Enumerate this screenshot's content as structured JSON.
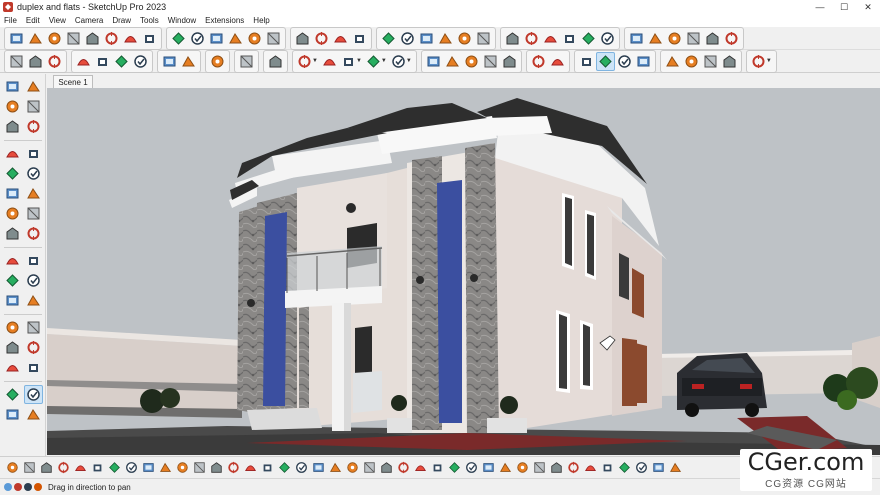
{
  "window": {
    "title": "duplex and flats - SketchUp Pro 2023",
    "controls": {
      "minimize": "—",
      "maximize": "☐",
      "close": "✕"
    }
  },
  "menu": [
    "File",
    "Edit",
    "View",
    "Camera",
    "Draw",
    "Tools",
    "Window",
    "Extensions",
    "Help"
  ],
  "toolbar_top": {
    "groups": [
      [
        "warehouse-icon",
        "paint-icon",
        "circle-icon",
        "ring-icon",
        "lamp-icon",
        "sun-icon",
        "dome-icon",
        "cylinder-icon"
      ],
      [
        "orbit-icon",
        "box-icon",
        "cube-icon",
        "plant-icon",
        "layers-icon",
        "box-outline-icon"
      ],
      [
        "grid-icon",
        "grid2-icon",
        "puzzle-icon",
        "grid3-icon"
      ],
      [
        "map-icon",
        "book-icon",
        "home-icon",
        "gift-icon",
        "house-icon",
        "door-icon"
      ],
      [
        "check-icon",
        "palette-icon",
        "teapot-icon",
        "shield-icon",
        "spiral-icon",
        "rocket-icon"
      ],
      [
        "monitor-icon",
        "chart-icon",
        "window-icon",
        "window2-icon",
        "window3-icon",
        "house-outline-icon"
      ]
    ]
  },
  "toolbar_main": {
    "groups": [
      [
        "new-file-icon",
        "folder-open-icon",
        "save-icon"
      ],
      [
        "cut-icon",
        "copy-icon",
        "paste-icon",
        "erase-icon"
      ],
      [
        "undo-icon",
        "redo-icon"
      ],
      [
        "print-icon"
      ],
      [
        "model-info-icon"
      ],
      [
        "search-zoom-icon"
      ],
      [
        "select-arrow-icon",
        "eraser-icon",
        "pencil-icon",
        "arc-icon",
        "rectangle-icon"
      ],
      [
        "push-pull-icon",
        "move-icon",
        "rotate-icon",
        "scale-icon",
        "offset-icon"
      ],
      [
        "tape-measure-icon",
        "paint-bucket-icon"
      ],
      [
        "orbit-view-icon",
        "pan-hand-icon",
        "zoom-icon",
        "zoom-extents-icon"
      ],
      [
        "warehouse-3d-icon",
        "extension-icon",
        "layout-icon",
        "styles-icon"
      ],
      [
        "account-icon"
      ]
    ]
  },
  "scene": {
    "tab_label": "Scene 1"
  },
  "status": {
    "text": "Drag in direction to pan"
  },
  "watermark": {
    "main": "CGer.com",
    "sub": "CG资源 CG网站"
  }
}
